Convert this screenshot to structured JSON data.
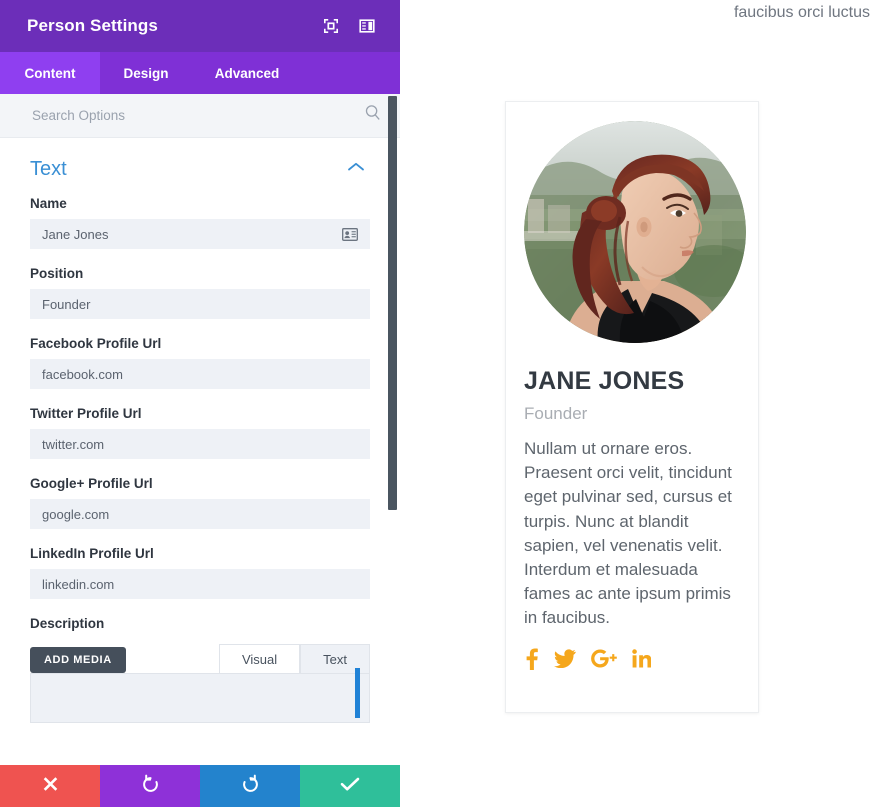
{
  "panel": {
    "title": "Person Settings",
    "header_icons": [
      {
        "name": "expand-fullscreen-icon"
      },
      {
        "name": "layout-panel-icon"
      }
    ],
    "tabs": [
      {
        "label": "Content",
        "active": true
      },
      {
        "label": "Design",
        "active": false
      },
      {
        "label": "Advanced",
        "active": false
      }
    ],
    "search": {
      "placeholder": "Search Options",
      "value": "",
      "icon": "search-icon"
    },
    "section": {
      "title": "Text",
      "toggle_icon": "chevron-up-icon"
    },
    "fields": [
      {
        "label": "Name",
        "value": "Jane Jones",
        "icon": "contact-card-icon"
      },
      {
        "label": "Position",
        "value": "Founder",
        "icon": ""
      },
      {
        "label": "Facebook Profile Url",
        "value": "facebook.com",
        "icon": ""
      },
      {
        "label": "Twitter Profile Url",
        "value": "twitter.com",
        "icon": ""
      },
      {
        "label": "Google+ Profile Url",
        "value": "google.com",
        "icon": ""
      },
      {
        "label": "LinkedIn Profile Url",
        "value": "linkedin.com",
        "icon": ""
      }
    ],
    "description": {
      "label": "Description",
      "add_media_label": "ADD MEDIA",
      "editor_tabs": [
        {
          "label": "Visual",
          "active": true
        },
        {
          "label": "Text",
          "active": false
        }
      ],
      "value": ""
    },
    "actions": [
      {
        "name": "cancel-button",
        "icon": "close-x-icon",
        "color": "#ef5350"
      },
      {
        "name": "undo-button",
        "icon": "undo-arrow-icon",
        "color": "#8e31d8"
      },
      {
        "name": "redo-button",
        "icon": "redo-arrow-icon",
        "color": "#2383cd"
      },
      {
        "name": "save-button",
        "icon": "checkmark-icon",
        "color": "#2fbf9a"
      }
    ]
  },
  "preview": {
    "page_snippet": "faucibus orci luctus",
    "person": {
      "avatar_alt": "portrait-photo-woman-auburn-hair",
      "name": "JANE JONES",
      "position": "Founder",
      "description": "Nullam ut ornare eros. Praesent orci velit, tincidunt eget pulvinar sed, cursus et turpis. Nunc at blandit sapien, vel venenatis velit. Interdum et malesuada fames ac ante ipsum primis in faucibus.",
      "social": [
        {
          "name": "facebook-icon",
          "label": "f"
        },
        {
          "name": "twitter-icon",
          "label": "twitter"
        },
        {
          "name": "google-plus-icon",
          "label": "G+"
        },
        {
          "name": "linkedin-icon",
          "label": "in"
        }
      ],
      "social_color": "#f5a71c"
    }
  },
  "colors": {
    "header_purple": "#6c2eb9",
    "tabs_purple": "#7f30d6",
    "active_tab_purple": "#8f3ff0",
    "section_blue": "#3a8fd4",
    "field_bg": "#eef1f6"
  }
}
